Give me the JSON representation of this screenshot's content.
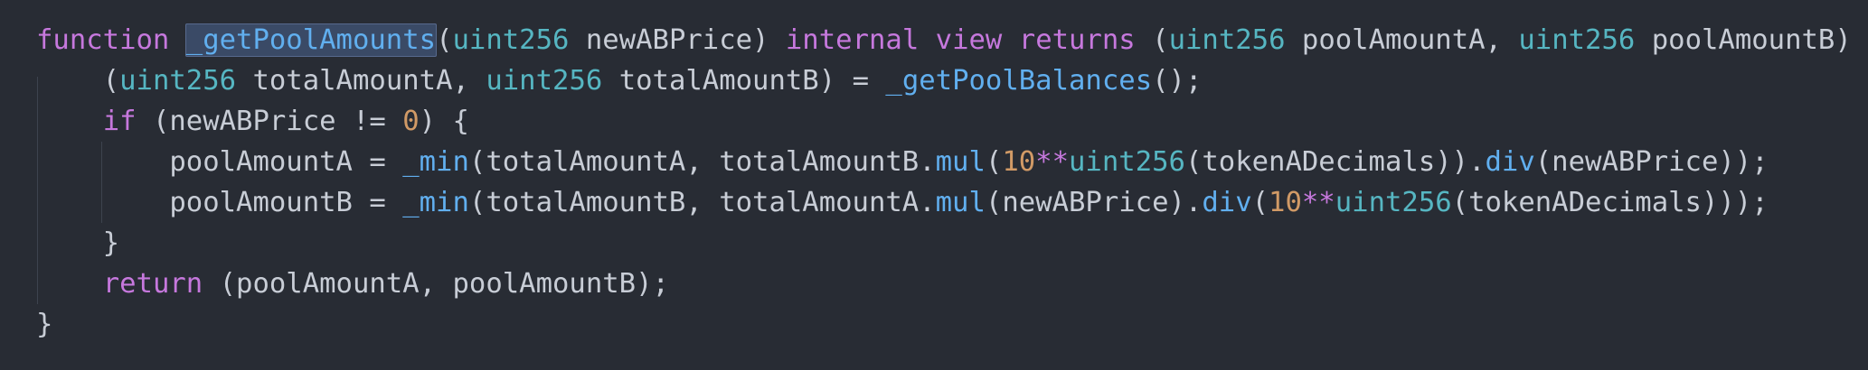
{
  "editor": {
    "language": "Solidity",
    "selected_token": "_getPoolAmounts",
    "colors": {
      "background": "#282c34",
      "keyword": "#c678dd",
      "type": "#56b6c2",
      "function": "#61afef",
      "number": "#d19a66",
      "text": "#c8cdd6",
      "selection": "#3a4a66"
    },
    "lines": [
      {
        "tokens": [
          {
            "t": "function",
            "k": "kw"
          },
          {
            "t": " ",
            "k": "txt"
          },
          {
            "t": "_getPoolAmounts",
            "k": "sel"
          },
          {
            "t": "(",
            "k": "txt"
          },
          {
            "t": "uint256",
            "k": "ty"
          },
          {
            "t": " newABPrice) ",
            "k": "txt"
          },
          {
            "t": "internal",
            "k": "kw"
          },
          {
            "t": " ",
            "k": "txt"
          },
          {
            "t": "view",
            "k": "kw"
          },
          {
            "t": " ",
            "k": "txt"
          },
          {
            "t": "returns",
            "k": "kw"
          },
          {
            "t": " (",
            "k": "txt"
          },
          {
            "t": "uint256",
            "k": "ty"
          },
          {
            "t": " poolAmountA, ",
            "k": "txt"
          },
          {
            "t": "uint256",
            "k": "ty"
          },
          {
            "t": " poolAmountB) {",
            "k": "txt"
          }
        ]
      },
      {
        "tokens": [
          {
            "t": "    (",
            "k": "txt"
          },
          {
            "t": "uint256",
            "k": "ty"
          },
          {
            "t": " totalAmountA, ",
            "k": "txt"
          },
          {
            "t": "uint256",
            "k": "ty"
          },
          {
            "t": " totalAmountB) = ",
            "k": "txt"
          },
          {
            "t": "_getPoolBalances",
            "k": "fn"
          },
          {
            "t": "();",
            "k": "txt"
          }
        ]
      },
      {
        "tokens": [
          {
            "t": "    ",
            "k": "txt"
          },
          {
            "t": "if",
            "k": "kw"
          },
          {
            "t": " (newABPrice != ",
            "k": "txt"
          },
          {
            "t": "0",
            "k": "num"
          },
          {
            "t": ") {",
            "k": "txt"
          }
        ]
      },
      {
        "tokens": [
          {
            "t": "        poolAmountA = ",
            "k": "txt"
          },
          {
            "t": "_min",
            "k": "fn"
          },
          {
            "t": "(totalAmountA, totalAmountB.",
            "k": "txt"
          },
          {
            "t": "mul",
            "k": "fn"
          },
          {
            "t": "(",
            "k": "txt"
          },
          {
            "t": "10",
            "k": "num"
          },
          {
            "t": "**",
            "k": "op"
          },
          {
            "t": "uint256",
            "k": "ty"
          },
          {
            "t": "(tokenADecimals)).",
            "k": "txt"
          },
          {
            "t": "div",
            "k": "fn"
          },
          {
            "t": "(newABPrice));",
            "k": "txt"
          }
        ]
      },
      {
        "tokens": [
          {
            "t": "        poolAmountB = ",
            "k": "txt"
          },
          {
            "t": "_min",
            "k": "fn"
          },
          {
            "t": "(totalAmountB, totalAmountA.",
            "k": "txt"
          },
          {
            "t": "mul",
            "k": "fn"
          },
          {
            "t": "(newABPrice).",
            "k": "txt"
          },
          {
            "t": "div",
            "k": "fn"
          },
          {
            "t": "(",
            "k": "txt"
          },
          {
            "t": "10",
            "k": "num"
          },
          {
            "t": "**",
            "k": "op"
          },
          {
            "t": "uint256",
            "k": "ty"
          },
          {
            "t": "(tokenADecimals)));",
            "k": "txt"
          }
        ]
      },
      {
        "tokens": [
          {
            "t": "    }",
            "k": "txt"
          }
        ]
      },
      {
        "tokens": [
          {
            "t": "    ",
            "k": "txt"
          },
          {
            "t": "return",
            "k": "kw"
          },
          {
            "t": " (poolAmountA, poolAmountB);",
            "k": "txt"
          }
        ]
      },
      {
        "tokens": [
          {
            "t": "}",
            "k": "txt"
          }
        ]
      }
    ]
  }
}
